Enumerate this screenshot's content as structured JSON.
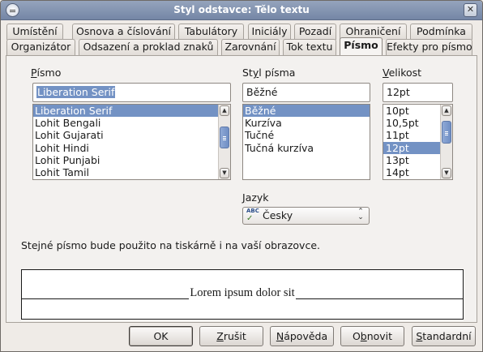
{
  "window": {
    "title": "Styl odstavce: Tělo textu"
  },
  "tabs_row1": [
    "Umístění",
    "Osnova a číslování",
    "Tabulátory",
    "Iniciály",
    "Pozadí",
    "Ohraničení",
    "Podmínka"
  ],
  "tabs_row2": [
    "Organizátor",
    "Odsazení a proklad znaků",
    "Zarovnání",
    "Tok textu",
    "Písmo",
    "Efekty pro písmo"
  ],
  "active_tab": "Písmo",
  "font": {
    "label": "Písmo",
    "value": "Liberation Serif",
    "list": [
      "Liberation Serif",
      "Lohit Bengali",
      "Lohit Gujarati",
      "Lohit Hindi",
      "Lohit Punjabi",
      "Lohit Tamil"
    ],
    "selected_index": 0
  },
  "style": {
    "label": "Styl písma",
    "value": "Běžné",
    "list": [
      "Běžné",
      "Kurzíva",
      "Tučné",
      "Tučná kurzíva"
    ],
    "selected_index": 0
  },
  "size": {
    "label": "Velikost",
    "value": "12pt",
    "list": [
      "10pt",
      "10,5pt",
      "11pt",
      "12pt",
      "13pt",
      "14pt"
    ],
    "selected_index": 3
  },
  "language": {
    "label": "Jazyk",
    "value": "Česky",
    "icon": "spellcheck-icon"
  },
  "info_text": "Stejné písmo bude použito na tiskárně i na vaší obrazovce.",
  "preview_text": "Lorem ipsum dolor sit",
  "buttons": {
    "ok": "OK",
    "cancel": "Zrušit",
    "help": "Nápověda",
    "reset": "Obnovit",
    "standard": "Standardní"
  },
  "colors": {
    "titlebar": "#7e8fad",
    "selection": "#7392c4"
  }
}
